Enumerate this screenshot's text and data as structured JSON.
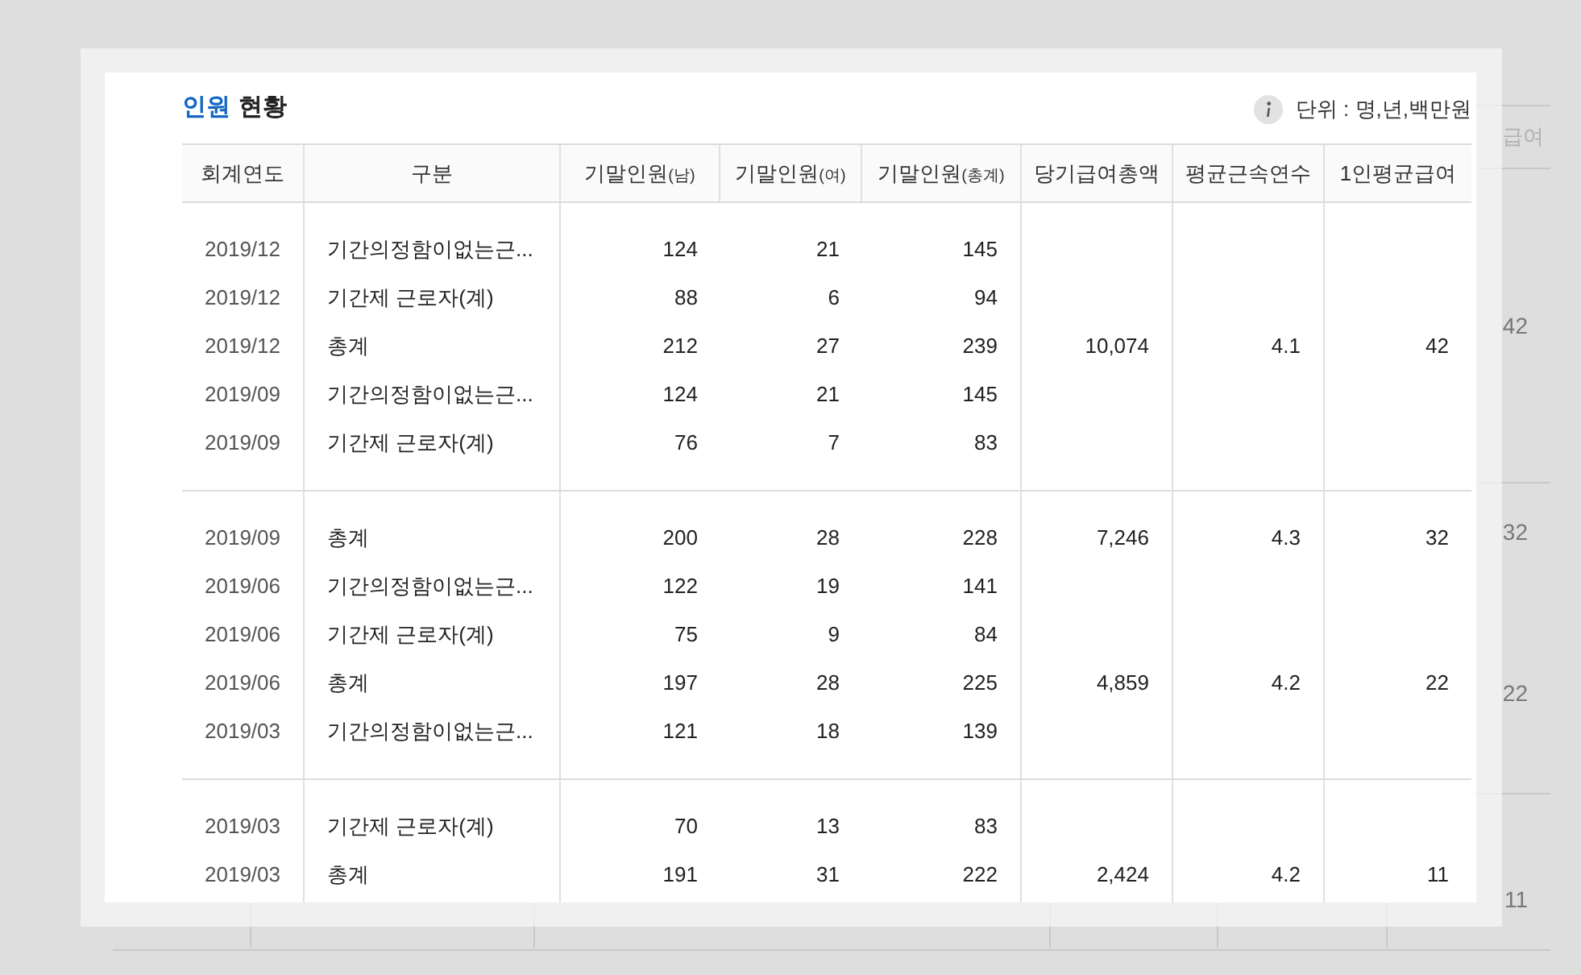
{
  "background": {
    "header_last": "급여",
    "last_column": [
      "42",
      "32",
      "22",
      "11"
    ]
  },
  "popup": {
    "title_highlight": "인원",
    "title_rest": "현황",
    "unit": "단위 : 명,년,백만원",
    "columns": [
      {
        "label": "회계연도"
      },
      {
        "label": "구분"
      },
      {
        "label": "기말인원",
        "sub": "(남)"
      },
      {
        "label": "기말인원",
        "sub": "(여)"
      },
      {
        "label": "기말인원",
        "sub": "(총계)"
      },
      {
        "label": "당기급여총액"
      },
      {
        "label": "평균근속연수"
      },
      {
        "label": "1인평균급여"
      }
    ],
    "groups": [
      {
        "rows": [
          {
            "period": "2019/12",
            "category": "기간의정함이없는근...",
            "male": "124",
            "female": "21",
            "total": "145"
          },
          {
            "period": "2019/12",
            "category": "기간제 근로자(계)",
            "male": "88",
            "female": "6",
            "total": "94"
          },
          {
            "period": "2019/12",
            "category": "총계",
            "male": "212",
            "female": "27",
            "total": "239",
            "pay": "10,074",
            "tenure": "4.1",
            "avg_pay": "42"
          },
          {
            "period": "2019/09",
            "category": "기간의정함이없는근...",
            "male": "124",
            "female": "21",
            "total": "145"
          },
          {
            "period": "2019/09",
            "category": "기간제 근로자(계)",
            "male": "76",
            "female": "7",
            "total": "83"
          }
        ]
      },
      {
        "rows": [
          {
            "period": "2019/09",
            "category": "총계",
            "male": "200",
            "female": "28",
            "total": "228",
            "pay": "7,246",
            "tenure": "4.3",
            "avg_pay": "32"
          },
          {
            "period": "2019/06",
            "category": "기간의정함이없는근...",
            "male": "122",
            "female": "19",
            "total": "141"
          },
          {
            "period": "2019/06",
            "category": "기간제 근로자(계)",
            "male": "75",
            "female": "9",
            "total": "84"
          },
          {
            "period": "2019/06",
            "category": "총계",
            "male": "197",
            "female": "28",
            "total": "225",
            "pay": "4,859",
            "tenure": "4.2",
            "avg_pay": "22"
          },
          {
            "period": "2019/03",
            "category": "기간의정함이없는근...",
            "male": "121",
            "female": "18",
            "total": "139"
          }
        ]
      },
      {
        "rows": [
          {
            "period": "2019/03",
            "category": "기간제 근로자(계)",
            "male": "70",
            "female": "13",
            "total": "83"
          },
          {
            "period": "2019/03",
            "category": "총계",
            "male": "191",
            "female": "31",
            "total": "222",
            "pay": "2,424",
            "tenure": "4.2",
            "avg_pay": "11"
          }
        ]
      }
    ]
  }
}
